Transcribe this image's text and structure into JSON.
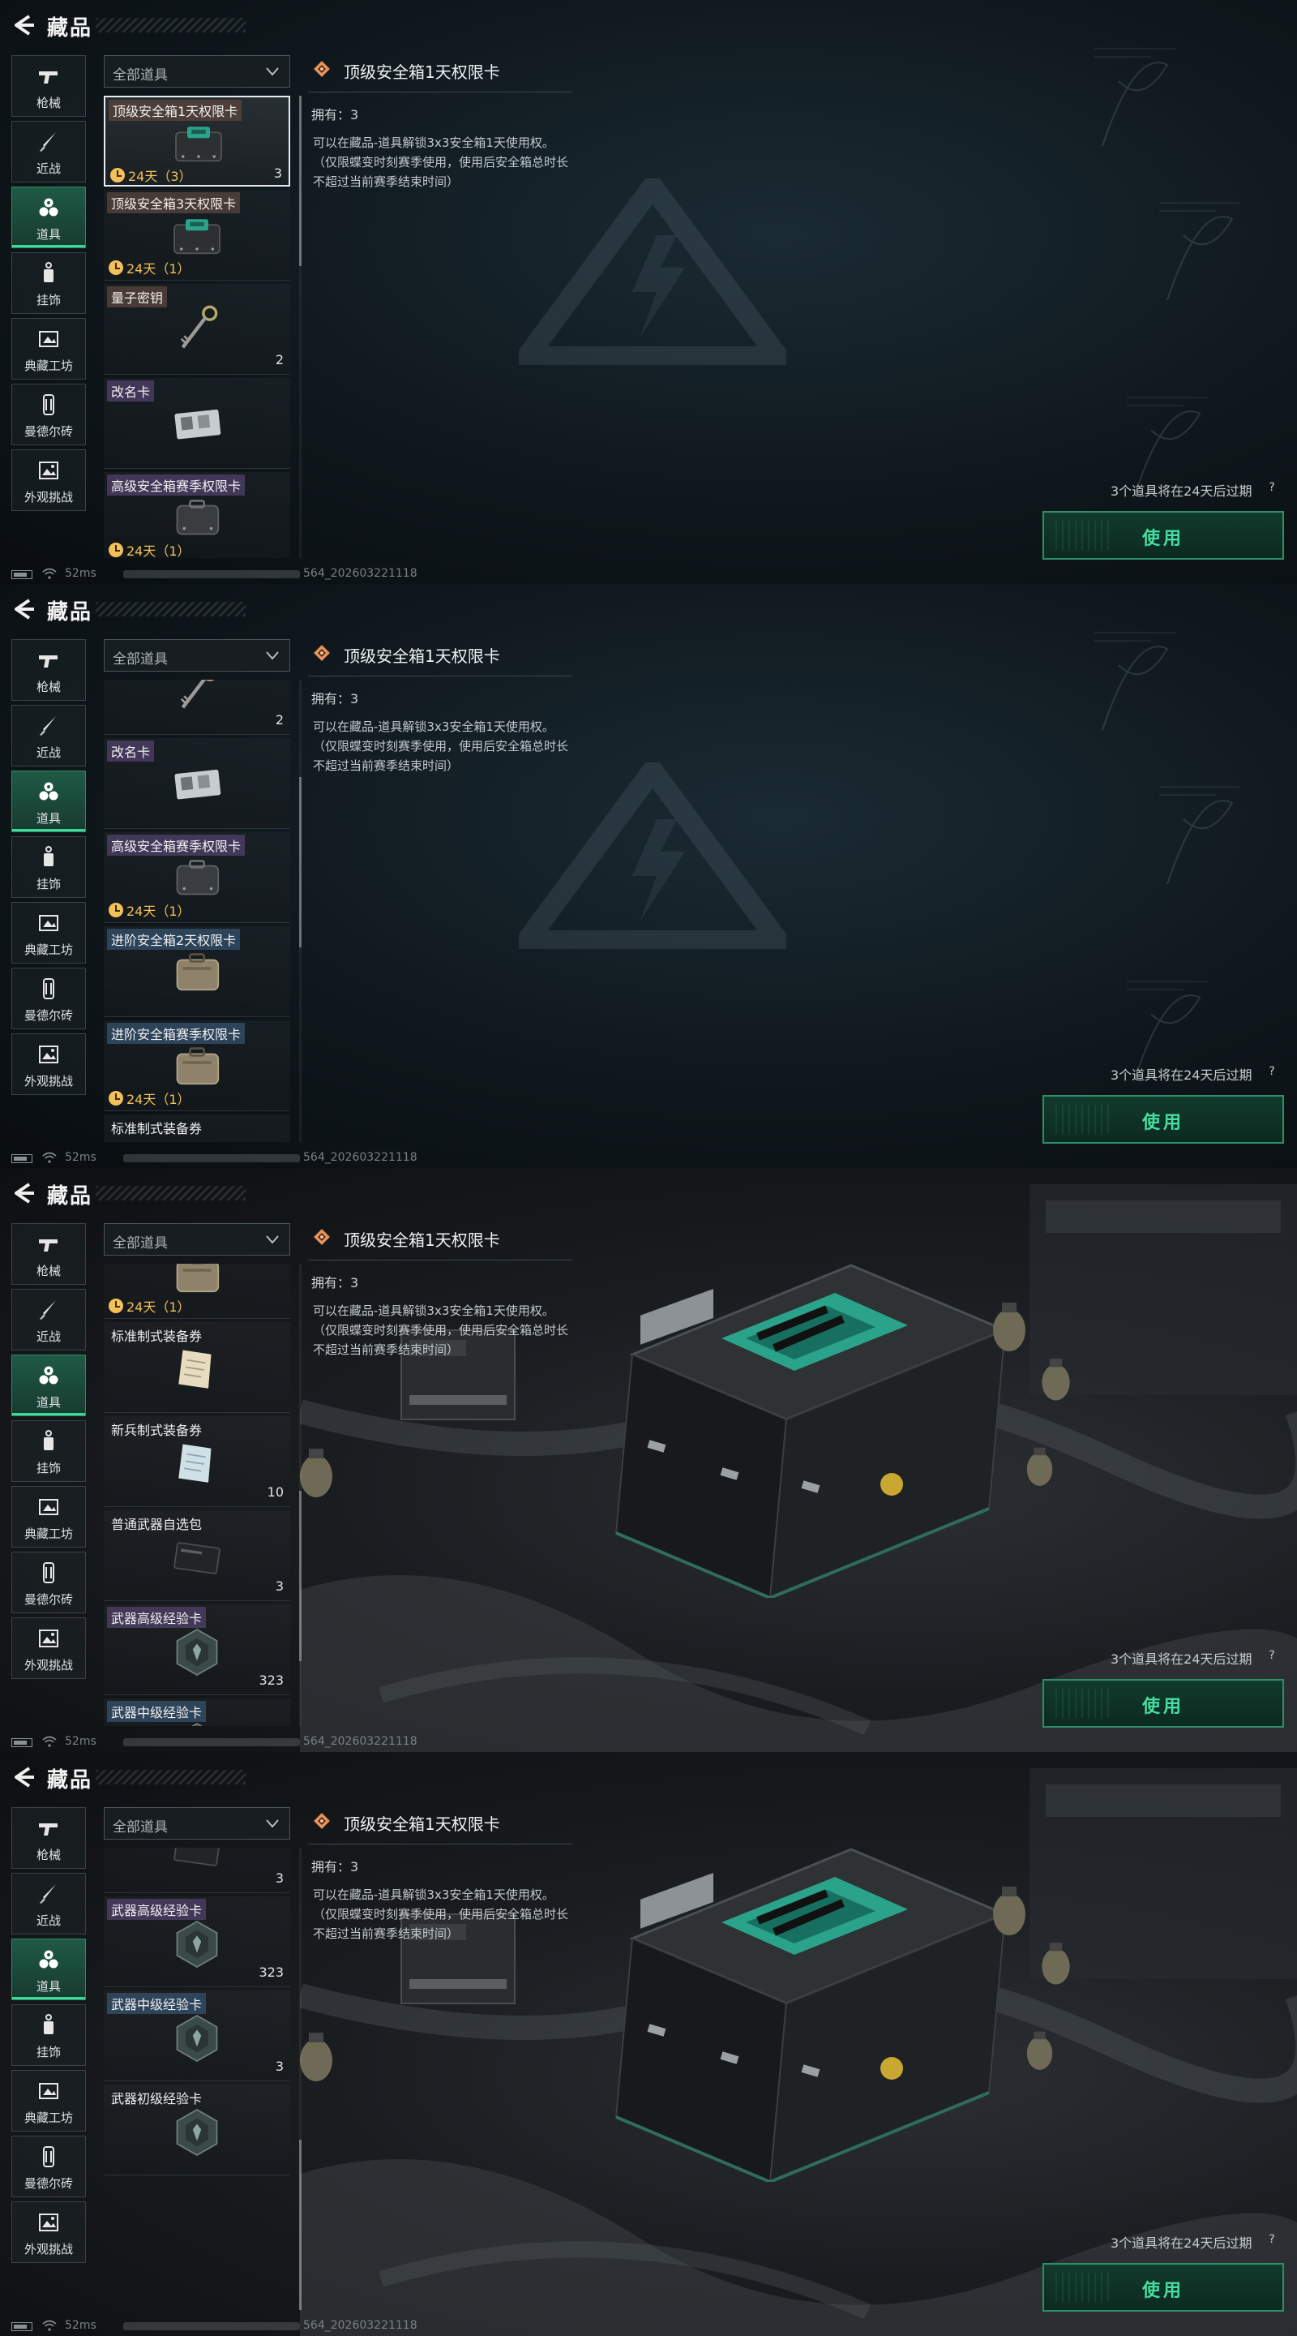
{
  "header": {
    "title": "藏品"
  },
  "sidebar": {
    "items": [
      {
        "label": "枪械",
        "icon": "pistol-icon"
      },
      {
        "label": "近战",
        "icon": "knife-icon"
      },
      {
        "label": "道具",
        "icon": "items-icon"
      },
      {
        "label": "挂饰",
        "icon": "charm-icon"
      },
      {
        "label": "典藏工坊",
        "icon": "workshop-icon"
      },
      {
        "label": "曼德尔砖",
        "icon": "brick-icon"
      },
      {
        "label": "外观挑战",
        "icon": "challenge-icon"
      }
    ],
    "active": "道具"
  },
  "filter": {
    "label": "全部道具"
  },
  "detail": {
    "title": "顶级安全箱1天权限卡",
    "owned": "拥有：3",
    "description": "可以在藏品-道具解锁3x3安全箱1天使用权。（仅限蝶变时刻赛季使用，使用后安全箱总时长不超过当前赛季结束时间）",
    "expire_note": "3个道具将在24天后过期",
    "help": "?",
    "use_button": "使用"
  },
  "status": {
    "ping": "52ms",
    "build_suffix": "564_20260322111​8"
  },
  "items": [
    {
      "name": "顶级安全箱1天权限卡",
      "timer": "24天（3）",
      "count": "3",
      "tag": "brown",
      "icon": "safebox-icon"
    },
    {
      "name": "顶级安全箱3天权限卡",
      "timer": "24天（1）",
      "count": "",
      "tag": "brown",
      "icon": "safebox-icon"
    },
    {
      "name": "量子密钥",
      "timer": "",
      "count": "2",
      "tag": "brown",
      "icon": "key-icon"
    },
    {
      "name": "改名卡",
      "timer": "",
      "count": "",
      "tag": "purple",
      "icon": "rename-card-icon"
    },
    {
      "name": "高级安全箱赛季权限卡",
      "timer": "24天（1）",
      "count": "",
      "tag": "purple",
      "icon": "case-icon"
    },
    {
      "name": "进阶安全箱2天权限卡",
      "timer": "",
      "count": "",
      "tag": "blue",
      "icon": "tan-case-icon"
    },
    {
      "name": "进阶安全箱赛季权限卡",
      "timer": "24天（1）",
      "count": "",
      "tag": "blue",
      "icon": "tan-case-icon"
    },
    {
      "name": "标准制式装备券",
      "timer": "",
      "count": "",
      "tag": "plain",
      "icon": "voucher-icon"
    },
    {
      "name": "新兵制式装备券",
      "timer": "",
      "count": "10",
      "tag": "plain",
      "icon": "voucher-blue-icon"
    },
    {
      "name": "普通武器自选包",
      "timer": "",
      "count": "3",
      "tag": "plain",
      "icon": "weapon-pack-icon"
    },
    {
      "name": "武器高级经验卡",
      "timer": "",
      "count": "323",
      "tag": "purple",
      "icon": "exp-hex-icon"
    },
    {
      "name": "武器中级经验卡",
      "timer": "",
      "count": "3",
      "tag": "blue",
      "icon": "exp-hex-icon"
    },
    {
      "name": "武器初级经验卡",
      "timer": "",
      "count": "",
      "tag": "plain",
      "icon": "exp-hex-icon"
    }
  ],
  "colors": {
    "accent": "#46e0a2",
    "timer": "#f2c15a",
    "active_tab": "#1f5a45"
  }
}
